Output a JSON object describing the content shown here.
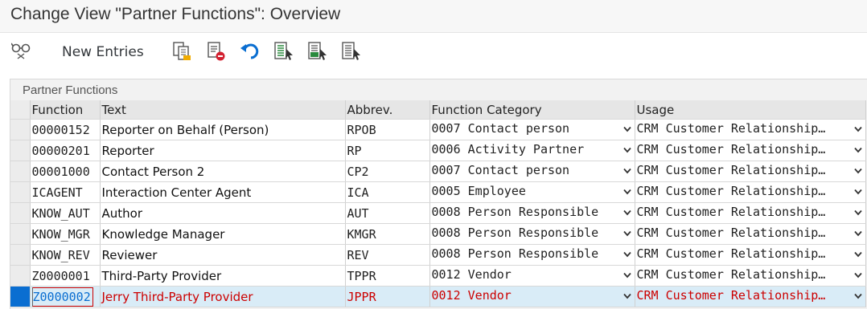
{
  "window": {
    "title": "Change View \"Partner Functions\": Overview"
  },
  "toolbar": {
    "new_entries_label": "New Entries",
    "icons": [
      "glasses-icon",
      "copy-icon",
      "delete-icon",
      "undo-icon",
      "select-all-icon",
      "select-block-icon",
      "deselect-all-icon"
    ]
  },
  "panel": {
    "title": "Partner Functions",
    "columns": {
      "function": "Function",
      "text": "Text",
      "abbrev": "Abbrev.",
      "category": "Function Category",
      "usage": "Usage"
    },
    "rows": [
      {
        "function": "00000152",
        "text": "Reporter on Behalf (Person)",
        "abbrev": "RPOB",
        "category": "0007 Contact person",
        "usage": "CRM Customer Relationship…"
      },
      {
        "function": "00000201",
        "text": "Reporter",
        "abbrev": "RP",
        "category": "0006 Activity Partner",
        "usage": "CRM Customer Relationship…"
      },
      {
        "function": "00001000",
        "text": "Contact Person 2",
        "abbrev": "CP2",
        "category": "0007 Contact person",
        "usage": "CRM Customer Relationship…"
      },
      {
        "function": "ICAGENT",
        "text": "Interaction Center Agent",
        "abbrev": "ICA",
        "category": "0005 Employee",
        "usage": "CRM Customer Relationship…"
      },
      {
        "function": "KNOW_AUT",
        "text": "Author",
        "abbrev": "AUT",
        "category": "0008 Person Responsible",
        "usage": "CRM Customer Relationship…"
      },
      {
        "function": "KNOW_MGR",
        "text": "Knowledge Manager",
        "abbrev": "KMGR",
        "category": "0008 Person Responsible",
        "usage": "CRM Customer Relationship…"
      },
      {
        "function": "KNOW_REV",
        "text": "Reviewer",
        "abbrev": "REV",
        "category": "0008 Person Responsible",
        "usage": "CRM Customer Relationship…"
      },
      {
        "function": "Z0000001",
        "text": "Third-Party Provider",
        "abbrev": "TPPR",
        "category": "0012 Vendor",
        "usage": "CRM Customer Relationship…"
      },
      {
        "function": "Z0000002",
        "text": "Jerry Third-Party Provider",
        "abbrev": "JPPR",
        "category": "0012 Vendor",
        "usage": "CRM Customer Relationship…"
      }
    ]
  },
  "colors": {
    "accent": "#0a6ed1",
    "error_text": "#cc0000",
    "active_row": "#d9ecf7"
  }
}
